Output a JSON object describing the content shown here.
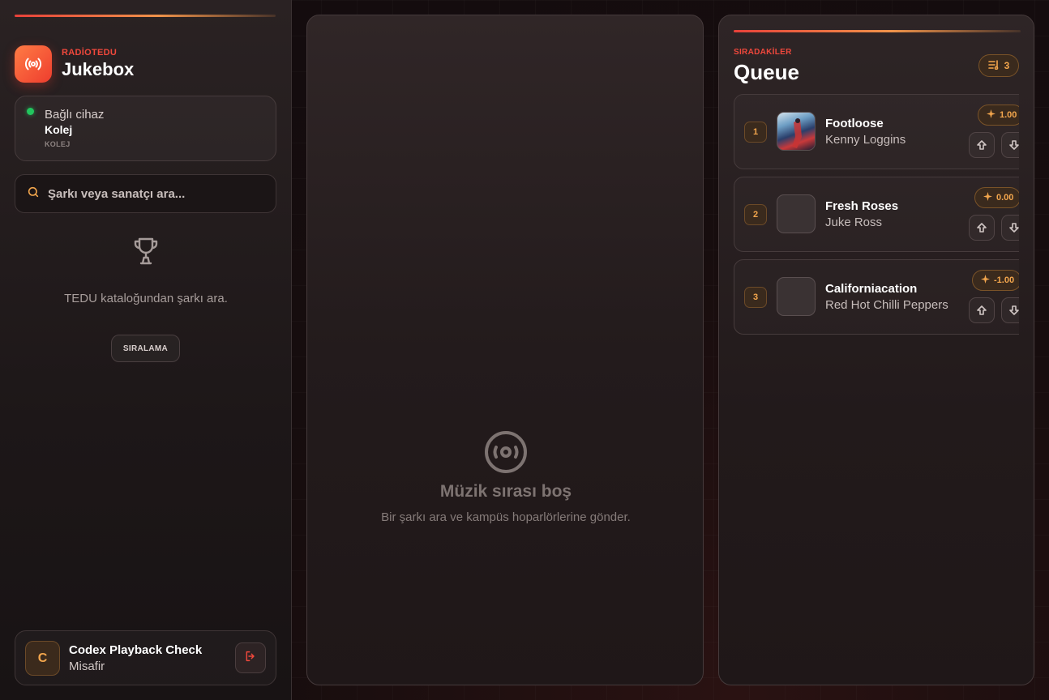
{
  "brand": {
    "kicker": "RADİOTEDU",
    "title": "Jukebox"
  },
  "device": {
    "label": "Bağlı cihaz",
    "name": "Kolej",
    "code": "KOLEJ",
    "status_color": "#22c55e"
  },
  "search": {
    "placeholder": "Şarkı veya sanatçı ara..."
  },
  "catalog": {
    "hint": "TEDU kataloğundan şarkı ara.",
    "ranking_label": "SIRALAMA"
  },
  "user": {
    "initial": "C",
    "name": "Codex Playback Check",
    "role": "Misafir"
  },
  "player": {
    "empty_title": "Müzik sırası boş",
    "empty_subtitle": "Bir şarkı ara ve kampüs hoparlörlerine gönder."
  },
  "queue": {
    "kicker": "SIRADAKİLER",
    "title": "Queue",
    "count": "3",
    "items": [
      {
        "position": "1",
        "title": "Footloose",
        "artist": "Kenny Loggins",
        "score": "1.00",
        "has_cover": true
      },
      {
        "position": "2",
        "title": "Fresh Roses",
        "artist": "Juke Ross",
        "score": "0.00",
        "has_cover": false
      },
      {
        "position": "3",
        "title": "Californiacation",
        "artist": "Red Hot Chilli Peppers",
        "score": "-1.00",
        "has_cover": false
      }
    ]
  },
  "colors": {
    "accent_red": "#f0483c",
    "accent_orange": "#f3a64d",
    "brand_gradient_start": "#ff7c45",
    "brand_gradient_end": "#ee3d2e"
  },
  "icons": {
    "brand": "broadcast-icon",
    "search": "search-icon",
    "trophy": "trophy-icon",
    "logout": "logout-icon",
    "empty": "disc-icon",
    "queue_count": "playlist-icon",
    "score": "sparkle-icon",
    "upvote": "arrow-up-icon",
    "downvote": "arrow-down-icon"
  }
}
